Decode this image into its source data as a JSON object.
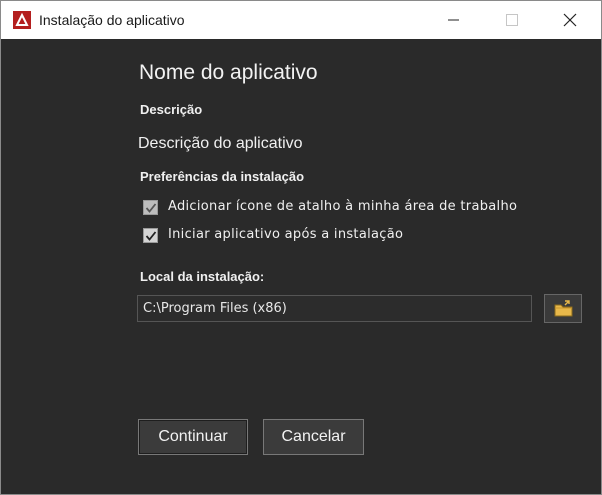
{
  "window": {
    "title": "Instalação do aplicativo",
    "controls": {
      "minimize": "minimize-icon",
      "maximize": "maximize-icon",
      "close": "close-icon"
    }
  },
  "app": {
    "name": "Nome do aplicativo",
    "description_label": "Descrição",
    "description": "Descrição do aplicativo"
  },
  "preferences": {
    "label": "Preferências da instalação",
    "options": [
      {
        "label": "Adicionar ícone de atalho à minha área de trabalho",
        "checked": true
      },
      {
        "label": "Iniciar aplicativo após a instalação",
        "checked": true
      }
    ]
  },
  "install": {
    "label": "Local da instalação:",
    "path": "C:\\Program Files (x86)"
  },
  "buttons": {
    "continue": "Continuar",
    "cancel": "Cancelar"
  },
  "colors": {
    "background": "#2a2a2a",
    "titlebar": "#ffffff",
    "app_icon": "#b41f1f",
    "folder_icon": "#e8b84a"
  }
}
